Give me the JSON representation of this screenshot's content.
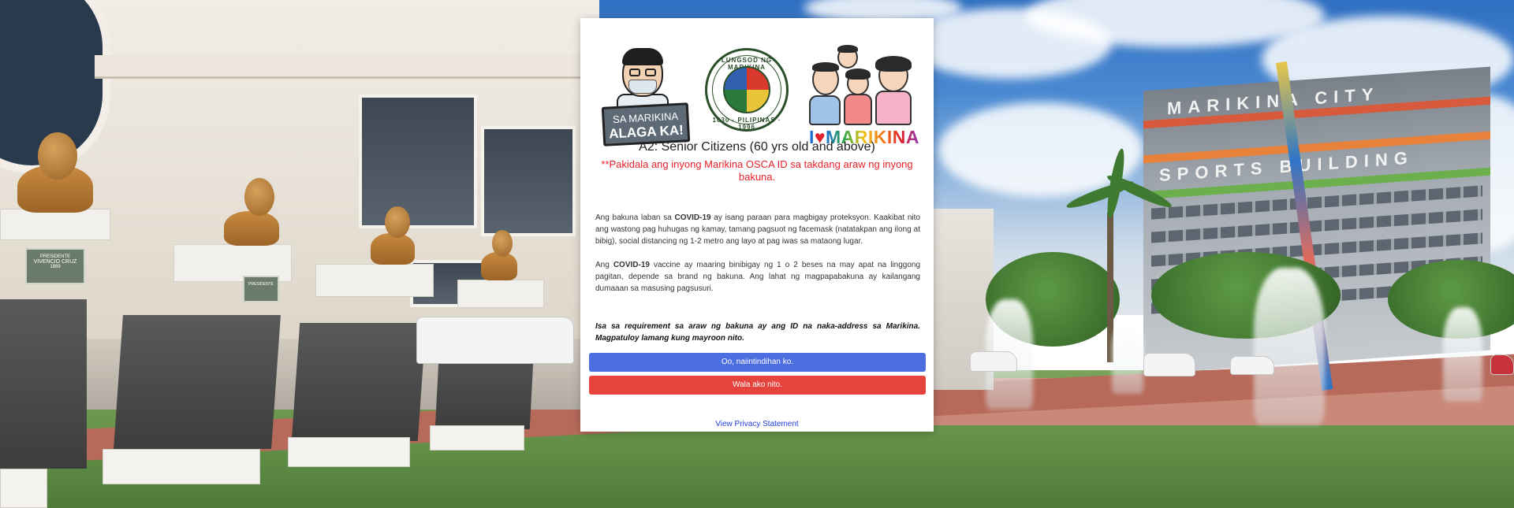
{
  "background": {
    "description_colors": {
      "sky": "#4b8ad2",
      "grass": "#5f8d45",
      "walkway": "#b76a5a"
    },
    "plaques": [
      {
        "line1": "PRESIDENTE",
        "line2": "VIVENCIO CRUZ",
        "line3": "1889"
      },
      {
        "line1": "PRESIDENTE",
        "line2": "",
        "line3": ""
      },
      {
        "line1": "",
        "line2": "",
        "line3": ""
      },
      {
        "line1": "",
        "line2": "",
        "line3": ""
      }
    ],
    "building_sign": {
      "line1": "MARIKINA  CITY",
      "line2": "SPORTS  BUILDING"
    }
  },
  "modal": {
    "logos": {
      "mascot": {
        "line1": "SA MARIKINA",
        "line2": "ALAGA KA!"
      },
      "seal": {
        "top_text": "LUNGSOD NG MARIKINA",
        "bottom_text": "1630 · PILIPINAS · 1996"
      },
      "love": {
        "i": "I",
        "heart": "♥",
        "word": "MARIKINA"
      }
    },
    "title": "A2: Senior Citizens (60 yrs old and above)",
    "notice": "**Pakidala ang inyong Marikina OSCA ID sa takdang araw ng inyong bakuna.",
    "paragraph1": {
      "before": "Ang bakuna laban sa ",
      "bold": "COVID-19",
      "after": " ay isang paraan para magbigay proteksyon. Kaakibat nito ang wastong pag huhugas ng kamay, tamang pagsuot ng facemask (natatakpan ang ilong at bibig), social distancing ng 1-2 metro ang layo at pag iwas sa mataong lugar."
    },
    "paragraph2": {
      "before": "Ang ",
      "bold": "COVID-19",
      "after": " vaccine ay maaring binibigay ng 1 o 2 beses na may apat na linggong pagitan, depende sa brand ng bakuna. Ang lahat ng magpapabakuna ay kailangang dumaaan sa masusing pagsusuri."
    },
    "requirement": "Isa sa requirement sa araw ng bakuna ay ang ID na naka-address sa Marikina. Magpatuloy lamang kung mayroon nito.",
    "buttons": {
      "confirm": "Oo, naiintindihan ko.",
      "decline": "Wala ako nito."
    },
    "privacy_link": "View Privacy Statement",
    "colors": {
      "confirm": "#4c6ee0",
      "decline": "#e5433b",
      "notice": "#e8212b",
      "link": "#1f3fdc"
    }
  }
}
